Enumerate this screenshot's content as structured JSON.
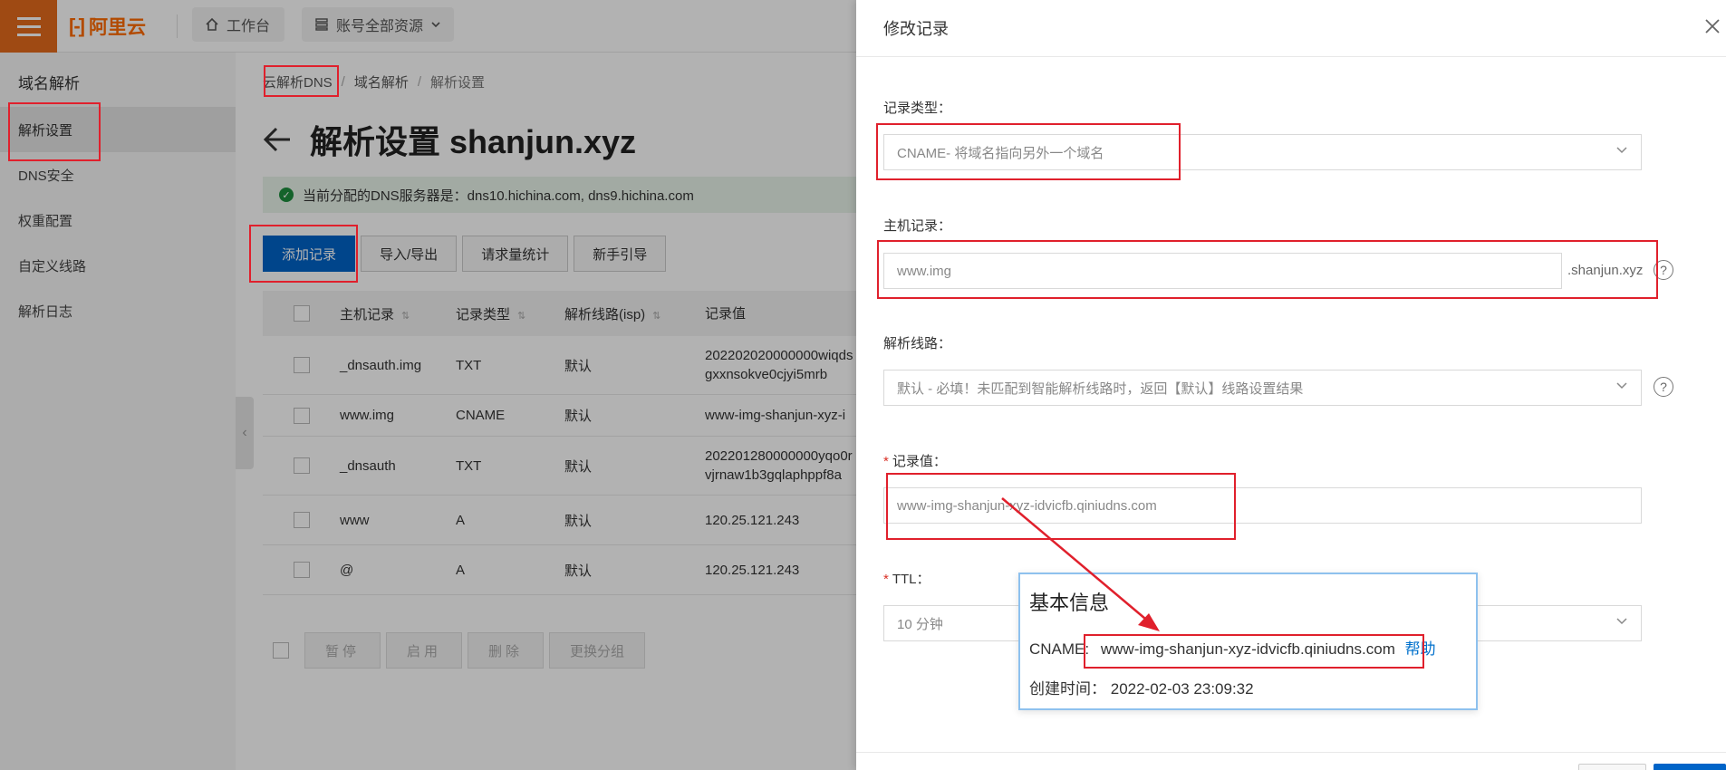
{
  "topbar": {
    "brand": "阿里云",
    "workbench_label": "工作台",
    "resource_label": "账号全部资源"
  },
  "leftnav": {
    "title": "域名解析",
    "items": [
      {
        "label": "解析设置"
      },
      {
        "label": "DNS安全"
      },
      {
        "label": "权重配置"
      },
      {
        "label": "自定义线路"
      },
      {
        "label": "解析日志"
      }
    ]
  },
  "main": {
    "breadcrumb": [
      "云解析DNS",
      "域名解析",
      "解析设置"
    ],
    "title": "解析设置 shanjun.xyz",
    "notice": "当前分配的DNS服务器是：dns10.hichina.com, dns9.hichina.com",
    "actions": [
      "添加记录",
      "导入/导出",
      "请求量统计",
      "新手引导"
    ],
    "table": {
      "headers": [
        "主机记录",
        "记录类型",
        "解析线路(isp)",
        "记录值"
      ],
      "rows": [
        {
          "host": "_dnsauth.img",
          "type": "TXT",
          "line": "默认",
          "value": "202202020000000wiqds",
          "value2": "gxxnsokve0cjyi5mrb"
        },
        {
          "host": "www.img",
          "type": "CNAME",
          "line": "默认",
          "value": "www-img-shanjun-xyz-i",
          "value2": ""
        },
        {
          "host": "_dnsauth",
          "type": "TXT",
          "line": "默认",
          "value": "202201280000000yqo0r",
          "value2": "vjrnaw1b3gqlaphppf8a"
        },
        {
          "host": "www",
          "type": "A",
          "line": "默认",
          "value": "120.25.121.243",
          "value2": ""
        },
        {
          "host": "@",
          "type": "A",
          "line": "默认",
          "value": "120.25.121.243",
          "value2": ""
        }
      ]
    },
    "bottom_actions": [
      "暂停",
      "启用",
      "删除",
      "更换分组"
    ]
  },
  "drawer": {
    "title": "修改记录",
    "record_type_label": "记录类型：",
    "record_type_value": "CNAME- 将域名指向另外一个域名",
    "host_label": "主机记录：",
    "host_value": "www.img",
    "host_suffix": ".shanjun.xyz",
    "line_label": "解析线路：",
    "line_value": "默认 - 必填！未匹配到智能解析线路时，返回【默认】线路设置结果",
    "value_label": "记录值：",
    "value_value": "www-img-shanjun-xyz-idvicfb.qiniudns.com",
    "ttl_label": "TTL：",
    "ttl_value": "10 分钟"
  },
  "info_card": {
    "title": "基本信息",
    "cname_label": "CNAME:",
    "cname_value": "www-img-shanjun-xyz-idvicfb.qiniudns.com",
    "help_link": "帮助",
    "created_label": "创建时间：",
    "created_value": "2022-02-03 23:09:32"
  },
  "colors": {
    "brand_orange": "#ff6a00",
    "primary_blue": "#0064c8",
    "annotation_red": "#e0202c"
  }
}
